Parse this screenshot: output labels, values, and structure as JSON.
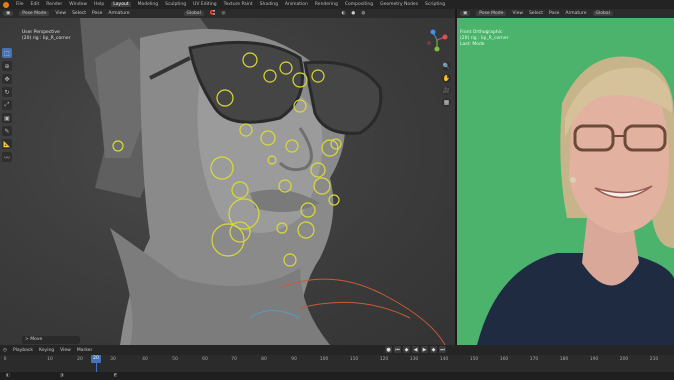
{
  "topbar": {
    "menus": [
      "File",
      "Edit",
      "Render",
      "Window",
      "Help"
    ],
    "workspaces": [
      "Layout",
      "Modeling",
      "Sculpting",
      "UV Editing",
      "Texture Paint",
      "Shading",
      "Animation",
      "Rendering",
      "Compositing",
      "Geometry Nodes",
      "Scripting"
    ],
    "active_workspace": "Layout"
  },
  "viewport": {
    "mode": "Pose Mode",
    "menus": [
      "View",
      "Select",
      "Pose",
      "Armature"
    ],
    "orientation": "Global",
    "pose_options": "Pose Options",
    "info_line1": "User Perspective",
    "info_line2": "(20) rig : lip_R_corner",
    "operator": "> Move",
    "tools": [
      "select-icon",
      "cursor-icon",
      "move-icon",
      "rotate-icon",
      "scale-icon",
      "transform-icon",
      "annotate-icon",
      "measure-icon",
      "relax-icon"
    ],
    "gizmo_axes": [
      "X",
      "Y",
      "Z"
    ]
  },
  "video_panel": {
    "mode": "Pose Mode",
    "menus": [
      "View",
      "Select",
      "Pose",
      "Armature"
    ],
    "orientation": "Global",
    "info_line1": "Front Orthographic",
    "info_line2": "(20) rig : lip_R_corner",
    "info_line3": "Last: Mode"
  },
  "timeline": {
    "playback": "Playback",
    "keying": "Keying",
    "menus": [
      "View",
      "Marker"
    ],
    "current_frame": "20",
    "ticks": [
      "0",
      "10",
      "20",
      "30",
      "40",
      "50",
      "60",
      "70",
      "80",
      "90",
      "100",
      "110",
      "120",
      "130",
      "140",
      "150",
      "160",
      "170",
      "180",
      "190",
      "200",
      "210"
    ]
  },
  "colors": {
    "accent": "#4772b3",
    "bone_yellow": "#d9d93a",
    "green_screen": "#4cb36c",
    "logo_orange": "#e87d0d"
  }
}
